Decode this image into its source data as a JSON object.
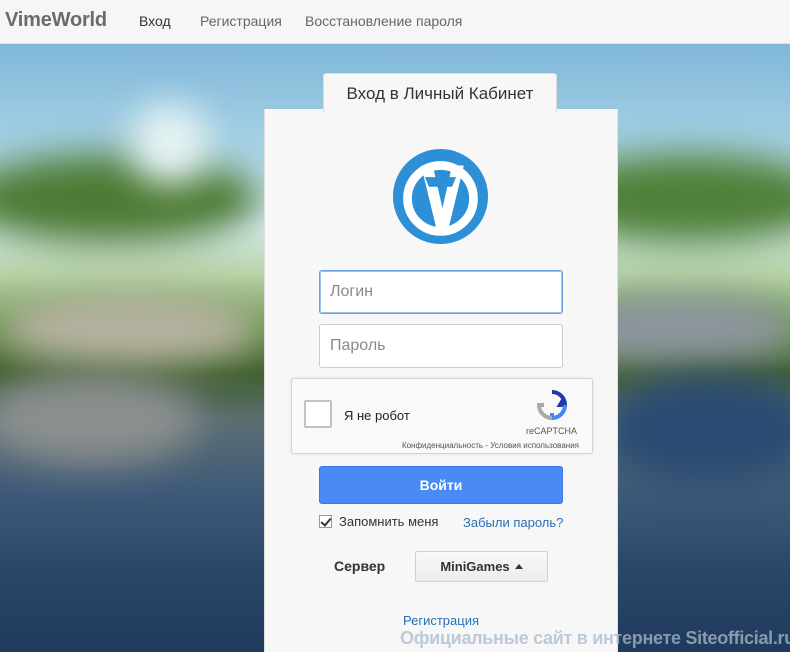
{
  "navbar": {
    "brand": "VimeWorld",
    "links": [
      {
        "label": "Вход"
      },
      {
        "label": "Регистрация"
      },
      {
        "label": "Восстановление пароля"
      }
    ]
  },
  "card": {
    "tab_title": "Вход в Личный Кабинет",
    "login_placeholder": "Логин",
    "password_placeholder": "Пароль",
    "captcha": {
      "label": "Я не робот",
      "brand": "reCAPTCHA",
      "links": "Конфиденциальность - Условия использования"
    },
    "submit_label": "Войти",
    "remember_label": "Запомнить меня",
    "remember_checked": true,
    "forgot_label": "Забыли пароль?",
    "server_label": "Сервер",
    "server_value": "MiniGames",
    "register_label": "Регистрация"
  },
  "watermark": "Официальные сайт в интернете Siteofficial.ru",
  "colors": {
    "accent": "#4a8af4",
    "logo_blue": "#2d8fd5",
    "link": "#2a6fb7"
  }
}
